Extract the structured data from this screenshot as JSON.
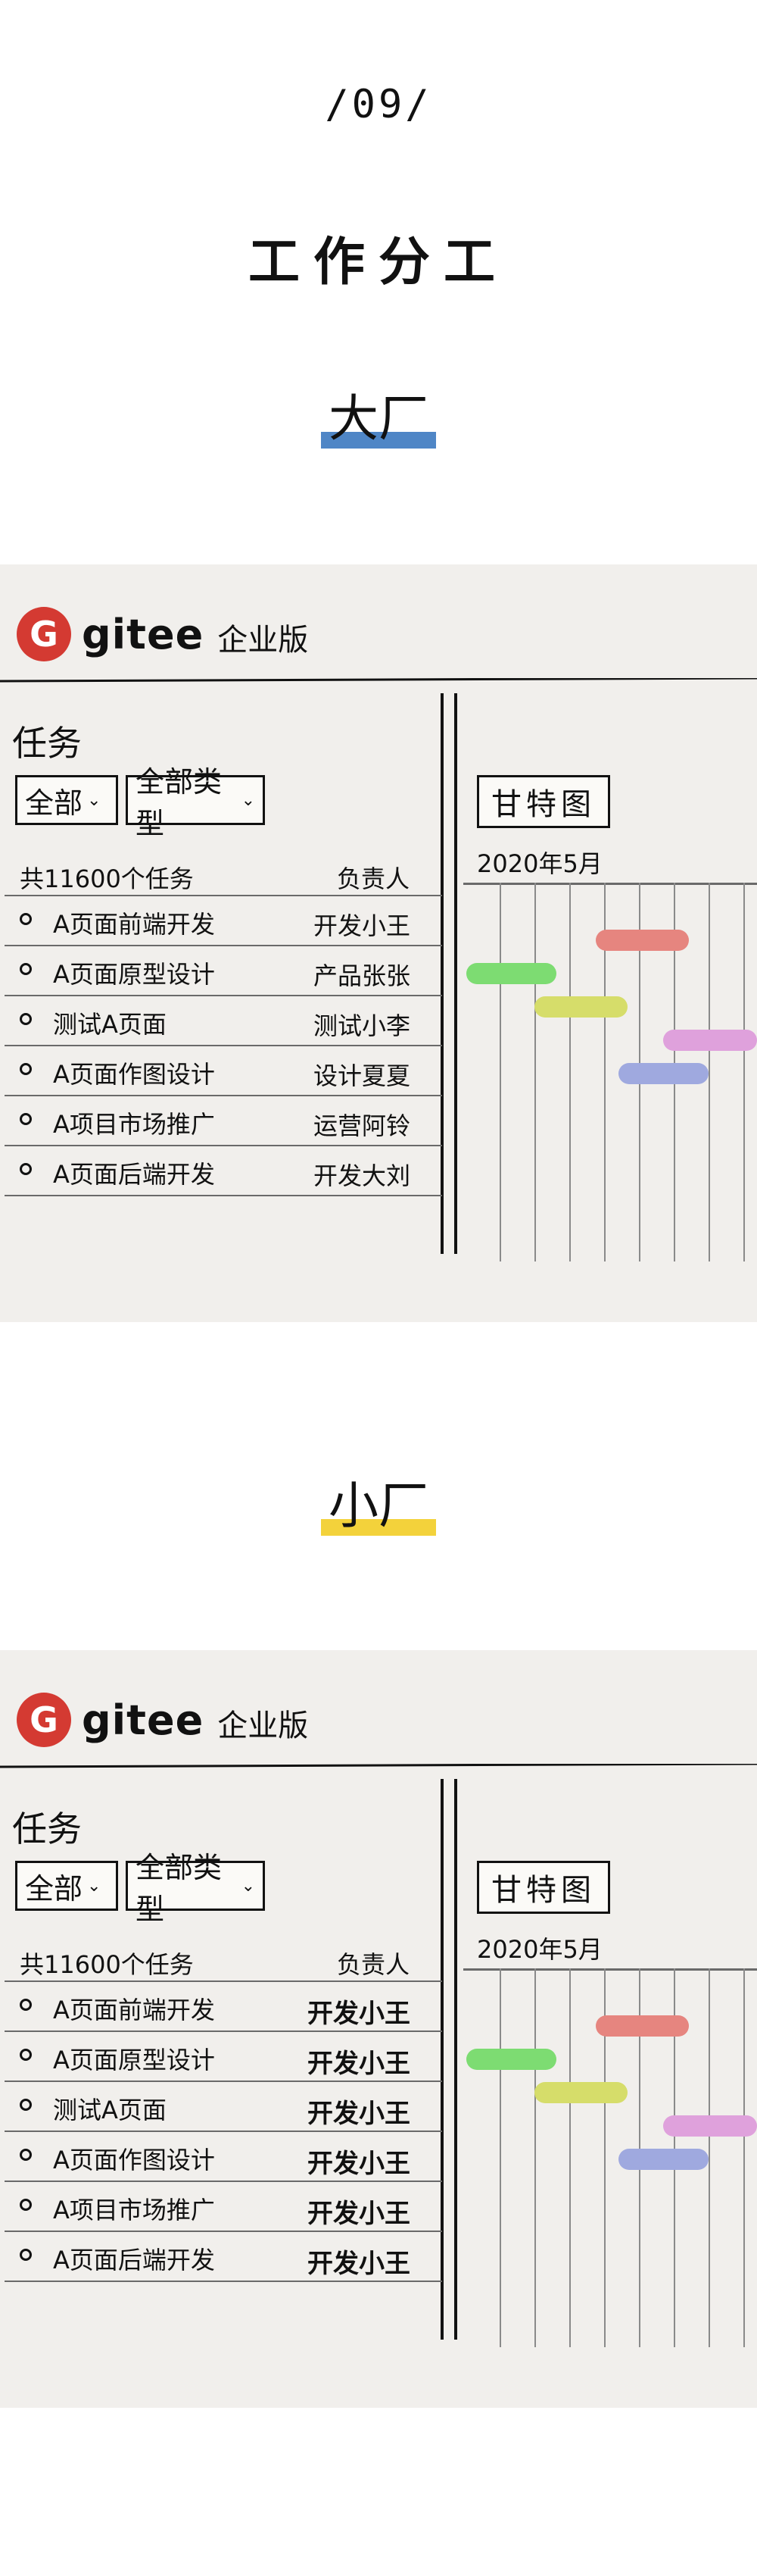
{
  "page_number": "/09/",
  "page_title": "工作分工",
  "colors": {
    "panel_bg": "#f1efec",
    "gitee_red": "#d43a32",
    "big_underline": "#4f86c6",
    "small_underline": "#f3d23b",
    "bar_colors": [
      "#e6857f",
      "#7ddc72",
      "#d6dd6a",
      "#dfa1dc",
      "#9fa9df"
    ]
  },
  "gantt_days": 9,
  "sections": [
    {
      "title": "大厂",
      "brand": {
        "logo_icon": "gitee-logo-icon",
        "logo_letter": "G",
        "name": "gitee",
        "edition": "企业版"
      },
      "tasks_heading": "任务",
      "filter_all": "全部",
      "filter_type": "全部类型",
      "list_count": "共11600个任务",
      "owner_header": "负责人",
      "tasks": [
        {
          "name": "A页面前端开发",
          "owner": "开发小王"
        },
        {
          "name": "A页面原型设计",
          "owner": "产品张张"
        },
        {
          "name": "测试A页面",
          "owner": "测试小李"
        },
        {
          "name": "A页面作图设计",
          "owner": "设计夏夏"
        },
        {
          "name": "A项目市场推广",
          "owner": "运营阿铃"
        },
        {
          "name": "A页面后端开发",
          "owner": "开发大刘"
        }
      ],
      "gantt_label": "甘特图",
      "gantt_month": "2020年5月",
      "gantt_bars": [
        {
          "start": 4,
          "end": 6.9
        },
        {
          "start": 0,
          "end": 2.8
        },
        {
          "start": 2.1,
          "end": 5.0
        },
        {
          "start": 6.1,
          "end": 9.0
        },
        {
          "start": 4.7,
          "end": 7.5
        }
      ]
    },
    {
      "title": "小厂",
      "brand": {
        "logo_icon": "gitee-logo-icon",
        "logo_letter": "G",
        "name": "gitee",
        "edition": "企业版"
      },
      "tasks_heading": "任务",
      "filter_all": "全部",
      "filter_type": "全部类型",
      "list_count": "共11600个任务",
      "owner_header": "负责人",
      "tasks": [
        {
          "name": "A页面前端开发",
          "owner": "开发小王"
        },
        {
          "name": "A页面原型设计",
          "owner": "开发小王"
        },
        {
          "name": "测试A页面",
          "owner": "开发小王"
        },
        {
          "name": "A页面作图设计",
          "owner": "开发小王"
        },
        {
          "name": "A项目市场推广",
          "owner": "开发小王"
        },
        {
          "name": "A页面后端开发",
          "owner": "开发小王"
        }
      ],
      "gantt_label": "甘特图",
      "gantt_month": "2020年5月",
      "gantt_bars": [
        {
          "start": 4,
          "end": 6.9
        },
        {
          "start": 0,
          "end": 2.8
        },
        {
          "start": 2.1,
          "end": 5.0
        },
        {
          "start": 6.1,
          "end": 9.0
        },
        {
          "start": 4.7,
          "end": 7.5
        }
      ]
    }
  ]
}
